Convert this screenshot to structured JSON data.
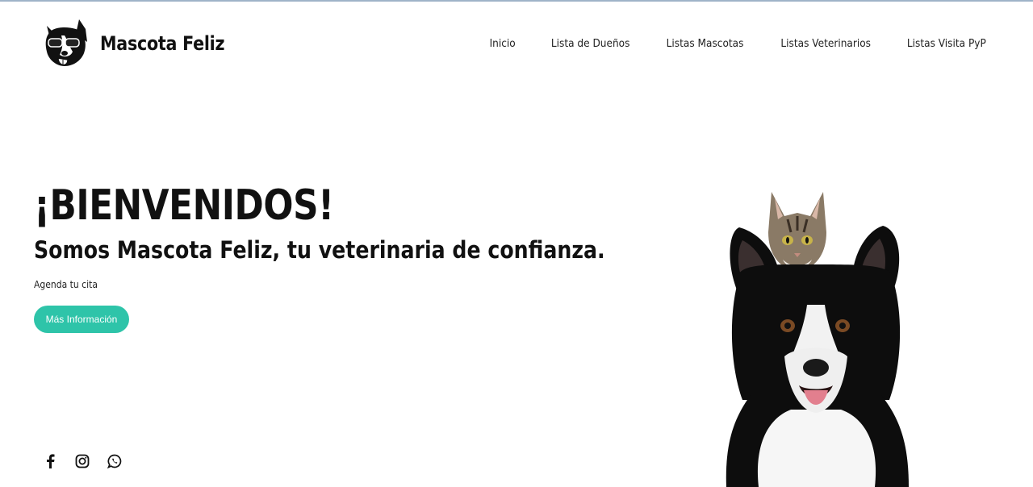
{
  "header": {
    "brand_name": "Mascota Feliz",
    "logo_icon": "dog-with-sunglasses-logo",
    "nav": [
      {
        "label": "Inicio"
      },
      {
        "label": "Lista de Dueños"
      },
      {
        "label": "Listas Mascotas"
      },
      {
        "label": "Listas Veterinarios"
      },
      {
        "label": "Listas Visita PyP"
      }
    ]
  },
  "hero": {
    "title": "¡BIENVENIDOS!",
    "subtitle": "Somos Mascota Feliz, tu veterinaria de confianza.",
    "note": "Agenda tu cita",
    "cta_label": "Más Información",
    "image": "dog-and-cat-photo"
  },
  "social": [
    {
      "icon": "facebook-icon"
    },
    {
      "icon": "instagram-icon"
    },
    {
      "icon": "whatsapp-icon"
    }
  ],
  "colors": {
    "accent": "#2ec4a9",
    "text": "#111111",
    "background": "#ffffff"
  }
}
